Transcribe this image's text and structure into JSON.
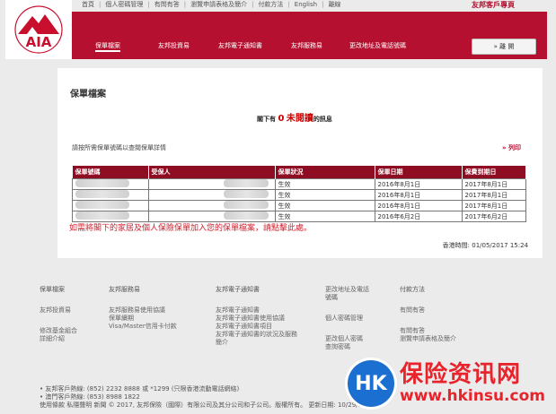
{
  "header": {
    "logo_text": "AIA",
    "brand_title": "友邦客戶專頁",
    "top_links": [
      "首頁",
      "個人密碼管理",
      "有問有答",
      "瀏覽申請表格及簡介",
      "付款方法",
      "English",
      "離線"
    ]
  },
  "nav": {
    "items": [
      "保單檔案",
      "友邦投資易",
      "友邦電子通知書",
      "友邦服務易",
      "更改地址及電話號碼"
    ],
    "logout_label": "» 離  開"
  },
  "main": {
    "title": "保單檔案",
    "unread_prefix": "閣下有",
    "unread_count": "0",
    "unread_word": "未閱讀",
    "unread_suffix": "的訊息",
    "instruction": "請按所需保單號碼以查閱保單詳情",
    "print_label": "» 列印",
    "table": {
      "headers": [
        "保單號碼",
        "受保人",
        "保單狀況",
        "保單日期",
        "保費到期日"
      ],
      "rows": [
        {
          "status": "生效",
          "policy_date": "2016年8月1日",
          "due_date": "2017年8月1日"
        },
        {
          "status": "生效",
          "policy_date": "2016年8月1日",
          "due_date": "2017年8月1日"
        },
        {
          "status": "生效",
          "policy_date": "2016年8月1日",
          "due_date": "2017年8月1日"
        },
        {
          "status": "生效",
          "policy_date": "2016年6月2日",
          "due_date": "2017年6月2日"
        }
      ]
    },
    "add_message": "如需將閣下的家居及個人保險保單加入您的保單檔案，請點擊此處。",
    "hk_time": "香港時間: 01/05/2017 15:24"
  },
  "footer": {
    "col1": {
      "head": "保單檔案",
      "sub": "友邦投資易",
      "links": [
        "修改基金組合",
        "詳細介紹"
      ]
    },
    "col2": {
      "head": "友邦服務易",
      "links": [
        "友邦服務易使用協議",
        "保單續期",
        "Visa/Master信用卡付款"
      ]
    },
    "col3": {
      "head": "友邦電子通知書",
      "links": [
        "友邦電子通知書",
        "友邦電子通知書使用協議",
        "友邦電子通知書項目",
        "友邦電子通知書的狀況及服務",
        "簡介"
      ]
    },
    "col4": {
      "head": "更改地址及電話",
      "head2": "號碼",
      "sub": "個人密碼管理",
      "links": [
        "更改個人密碼",
        "查詢密碼"
      ]
    },
    "col5": {
      "head": "付款方法",
      "sub": "有問有答",
      "links": [
        "有問有答",
        "瀏覽申請表格及簡介"
      ]
    },
    "hotlines": [
      "• 友邦客戶熱線: (852) 2232 8888 或 *1299 (只限香港流動電話網絡)",
      "• 澳門客戶熱線: (853) 8988 1822"
    ],
    "legal": "使用條款  私隱聲明  新聞  © 2017, 友邦保險（國際）有限公司及其分公司和子公司。版權所有。  更新日期: 10/29/2015"
  },
  "watermark": {
    "badge": "HK",
    "cn": "保险资讯网",
    "url": "www.hkinsu.com"
  }
}
